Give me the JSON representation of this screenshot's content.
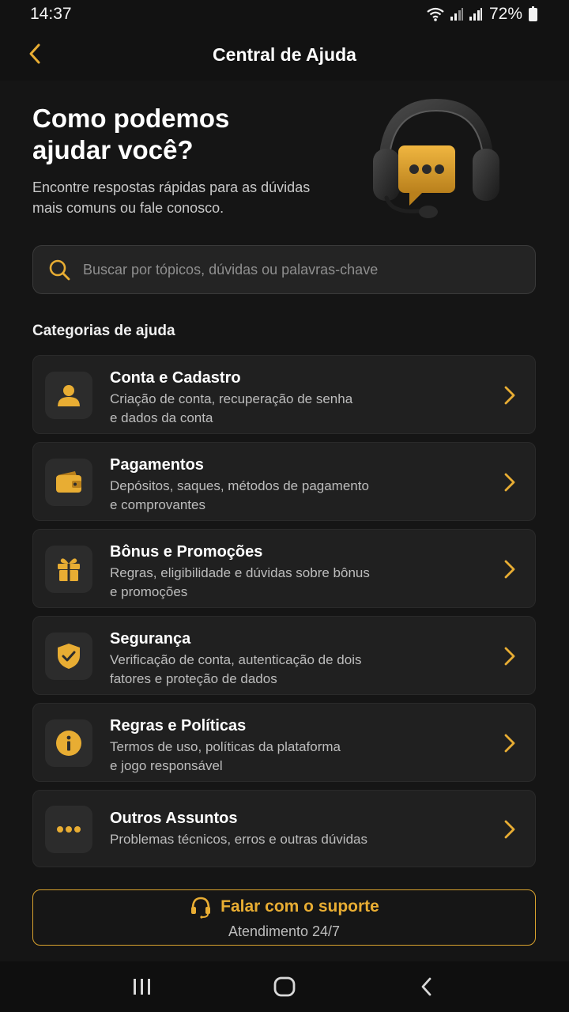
{
  "status_bar": {
    "time": "14:37",
    "battery": "72%",
    "icons": [
      "wifi-icon",
      "signal-icon",
      "signal-icon",
      "battery-icon"
    ]
  },
  "header": {
    "title": "Central de Ajuda",
    "back_icon": "chevron-left-icon"
  },
  "hero": {
    "title": "Como podemos ajudar você?",
    "subtitle": "Encontre respostas rápidas para as dúvidas mais comuns ou fale conosco.",
    "illustration": "headset-chat-icon"
  },
  "search": {
    "placeholder": "Buscar por tópicos, dúvidas ou palavras-chave",
    "icon": "search-icon"
  },
  "categories": {
    "section_title": "Categorias de ajuda",
    "items": [
      {
        "title": "Conta e Cadastro",
        "desc_line1": "Criação de conta, recuperação de senha",
        "desc_line2": "e dados da conta",
        "icon": "user-icon"
      },
      {
        "title": "Pagamentos",
        "desc_line1": "Depósitos, saques, métodos de pagamento",
        "desc_line2": "e comprovantes",
        "icon": "wallet-icon"
      },
      {
        "title": "Bônus e Promoções",
        "desc_line1": "Regras, eligibilidade e dúvidas sobre bônus",
        "desc_line2": "e promoções",
        "icon": "gift-icon"
      },
      {
        "title": "Segurança",
        "desc_line1": "Verificação de conta, autenticação de dois",
        "desc_line2": "fatores e proteção de dados",
        "icon": "shield-check-icon"
      },
      {
        "title": "Regras e Políticas",
        "desc_line1": "Termos de uso, políticas da plataforma",
        "desc_line2": "e jogo responsável",
        "icon": "info-icon"
      },
      {
        "title": "Outros Assuntos",
        "desc_line1": "Problemas técnicos, erros e outras dúvidas",
        "desc_line2": "",
        "icon": "more-dots-icon"
      }
    ]
  },
  "support": {
    "label": "Falar com o suporte",
    "sub": "Atendimento 24/7",
    "icon": "headset-icon"
  },
  "nav": {
    "buttons": [
      "recent-apps-icon",
      "home-icon",
      "back-icon"
    ]
  },
  "colors": {
    "accent": "#e8ad33",
    "background": "#151515",
    "card": "#202020"
  }
}
